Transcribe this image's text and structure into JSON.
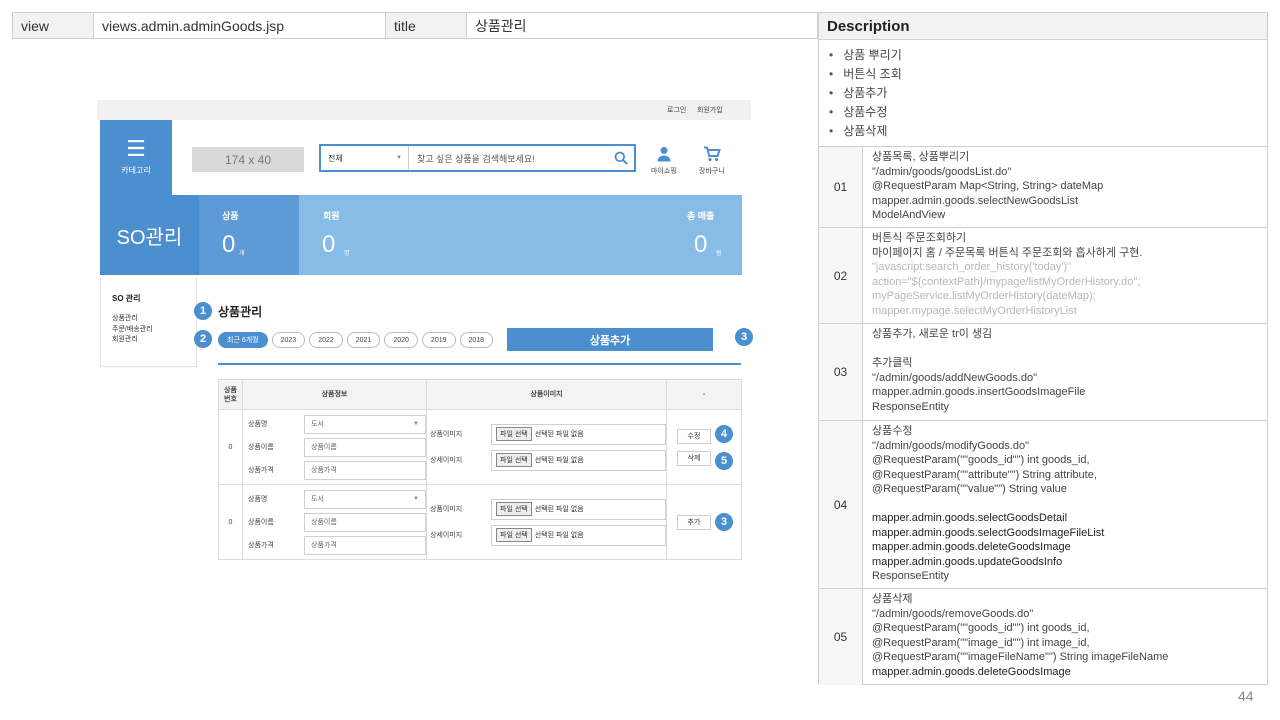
{
  "spec": {
    "view_label": "view",
    "view_value": "views.admin.adminGoods.jsp",
    "title_label": "title",
    "title_value": "상품관리"
  },
  "description": {
    "header": "Description",
    "bullets": [
      "상품 뿌리기",
      "버튼식 조회",
      "상품추가",
      "상품수정",
      "상품삭제"
    ],
    "rows": [
      {
        "num": "01",
        "lines": [
          {
            "t": "상품목록, 상품뿌리기",
            "s": "n"
          },
          {
            "t": "\"/admin/goods/goodsList.do\"",
            "s": "n"
          },
          {
            "t": "@RequestParam Map<String, String> dateMap",
            "s": "n"
          },
          {
            "t": "mapper.admin.goods.selectNewGoodsList",
            "s": "n"
          },
          {
            "t": "ModelAndView",
            "s": "n"
          }
        ]
      },
      {
        "num": "02",
        "lines": [
          {
            "t": "버튼식 주문조회하기",
            "s": "n"
          },
          {
            "t": "마이페이지 홈 / 주문목록 버튼식 주문조회와 흡사하게 구현.",
            "s": "n"
          },
          {
            "t": "\"javascript:search_order_history('today')\"",
            "s": "g"
          },
          {
            "t": "action=\"${contextPath}/mypage/listMyOrderHistory.do\";",
            "s": "g"
          },
          {
            "t": "myPageService.listMyOrderHistory(dateMap);",
            "s": "g"
          },
          {
            "t": "mapper.mypage.selectMyOrderHistoryList",
            "s": "g"
          }
        ]
      },
      {
        "num": "03",
        "lines": [
          {
            "t": "상품추가, 새로운 tr이 생김",
            "s": "n"
          },
          {
            "t": "",
            "s": "b"
          },
          {
            "t": "추가클릭",
            "s": "n"
          },
          {
            "t": "\"/admin/goods/addNewGoods.do\"",
            "s": "n"
          },
          {
            "t": "mapper.admin.goods.insertGoodsImageFile",
            "s": "n"
          },
          {
            "t": "ResponseEntity",
            "s": "n"
          }
        ]
      },
      {
        "num": "04",
        "lines": [
          {
            "t": "상품수정",
            "s": "n"
          },
          {
            "t": "\"/admin/goods/modifyGoods.do\"",
            "s": "n"
          },
          {
            "t": "@RequestParam(\"\"goods_id\"\") int goods_id,",
            "s": "n"
          },
          {
            "t": "@RequestParam(\"\"attribute\"\") String attribute,",
            "s": "n"
          },
          {
            "t": "@RequestParam(\"\"value\"\") String value",
            "s": "n"
          },
          {
            "t": "",
            "s": "b"
          },
          {
            "t": "mapper.admin.goods.selectGoodsDetail",
            "s": "d"
          },
          {
            "t": "mapper.admin.goods.selectGoodsImageFileList",
            "s": "d"
          },
          {
            "t": "mapper.admin.goods.deleteGoodsImage",
            "s": "d"
          },
          {
            "t": "mapper.admin.goods.updateGoodsInfo",
            "s": "d"
          },
          {
            "t": "ResponseEntity",
            "s": "n"
          }
        ]
      },
      {
        "num": "05",
        "lines": [
          {
            "t": "상품삭제",
            "s": "n"
          },
          {
            "t": "\"/admin/goods/removeGoods.do\"",
            "s": "n"
          },
          {
            "t": "@RequestParam(\"\"goods_id\"\") int goods_id,",
            "s": "n"
          },
          {
            "t": "@RequestParam(\"\"image_id\"\") int image_id,",
            "s": "n"
          },
          {
            "t": "@RequestParam(\"\"imageFileName\"\") String imageFileName",
            "s": "n"
          },
          {
            "t": "mapper.admin.goods.deleteGoodsImage",
            "s": "d"
          }
        ]
      }
    ]
  },
  "page_number": "44",
  "mockup": {
    "top_links": {
      "login": "로그인",
      "join": "회원가입"
    },
    "category_label": "카테고리",
    "logo_placeholder": "174 x 40",
    "search": {
      "category": "전체",
      "placeholder": "찾고 싶은 상품을 검색해보세요!"
    },
    "mypage_label": "마이쇼핑",
    "cart_label": "장바구니",
    "banner": {
      "title": "SO관리",
      "products_label": "상품",
      "products_value": "0",
      "products_unit": "개",
      "members_label": "회원",
      "members_value": "0",
      "members_unit": "명",
      "sales_label": "총 매출",
      "sales_value": "0",
      "sales_unit": "원"
    },
    "sidebar": {
      "heading": "SO 관리",
      "items": [
        "상품관리",
        "주문/배송관리",
        "회원관리"
      ]
    },
    "section_title": "상품관리",
    "year_buttons": [
      "최근 6개월",
      "2023",
      "2022",
      "2021",
      "2020",
      "2019",
      "2018"
    ],
    "add_button": "상품추가",
    "badges": [
      "1",
      "2",
      "3",
      "4",
      "5",
      "3"
    ],
    "table": {
      "headers": {
        "no": "상품\n번호",
        "info": "상품정보",
        "image": "상품이미지",
        "action": "-"
      },
      "rows": [
        {
          "no": "0",
          "type_label": "상품명",
          "type_value": "도서",
          "name_label": "상품이름",
          "name_placeholder": "상품이름",
          "price_label": "상품가격",
          "price_placeholder": "상품가격",
          "image_label": "상품이미지",
          "detail_label": "상세이미지",
          "file_button": "파일 선택",
          "file_status": "선택된 파일 없음",
          "actions": [
            "수정",
            "삭제"
          ]
        },
        {
          "no": "0",
          "type_label": "상품명",
          "type_value": "도서",
          "name_label": "상품이름",
          "name_placeholder": "상품이름",
          "price_label": "상품가격",
          "price_placeholder": "상품가격",
          "image_label": "상품이미지",
          "detail_label": "상세이미지",
          "file_button": "파일 선택",
          "file_status": "선택된 파일 없음",
          "actions": [
            "추가"
          ]
        }
      ]
    }
  }
}
